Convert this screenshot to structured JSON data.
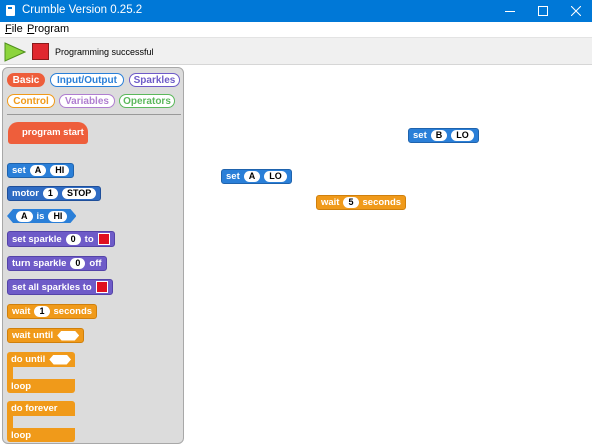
{
  "window": {
    "title": "Crumble Version 0.25.2",
    "title_bar_color": "#0078d7"
  },
  "menu": [
    {
      "label": "File",
      "accel": "F",
      "rest": "ile"
    },
    {
      "label": "Program",
      "accel": "P",
      "rest": "rogram"
    }
  ],
  "toolbar": {
    "status": "Programming successful"
  },
  "categories": [
    {
      "label": "Basic",
      "active": true,
      "color": "#ee5e3b"
    },
    {
      "label": "Input/Output",
      "color": "#2a7fd8"
    },
    {
      "label": "Sparkles",
      "color": "#6e5bc8"
    },
    {
      "label": "Control",
      "color": "#f09a1a"
    },
    {
      "label": "Variables",
      "color": "#b07ed0"
    },
    {
      "label": "Operators",
      "color": "#5cb85c"
    }
  ],
  "palette": {
    "program_start": "program start",
    "set_a": {
      "verb": "set",
      "pin": "A",
      "value": "HI"
    },
    "motor": {
      "verb": "motor",
      "num": "1",
      "state": "STOP"
    },
    "is_cond": {
      "pin": "A",
      "word": "is",
      "value": "HI"
    },
    "set_sparkle": {
      "verb": "set sparkle",
      "num": "0",
      "to": "to"
    },
    "turn_sparkle": {
      "verb": "turn sparkle",
      "num": "0",
      "off": "off"
    },
    "set_all_sparkles": {
      "verb": "set all sparkles to"
    },
    "wait": {
      "verb": "wait",
      "num": "1",
      "unit": "seconds"
    },
    "wait_until": {
      "verb": "wait until"
    },
    "do_until": {
      "verb": "do until",
      "loop": "loop"
    },
    "do_forever": {
      "verb": "do forever",
      "loop": "loop"
    }
  },
  "canvas": {
    "set_b": {
      "verb": "set",
      "pin": "B",
      "value": "LO"
    },
    "set_a": {
      "verb": "set",
      "pin": "A",
      "value": "LO"
    },
    "wait": {
      "verb": "wait",
      "num": "5",
      "unit": "seconds"
    }
  }
}
